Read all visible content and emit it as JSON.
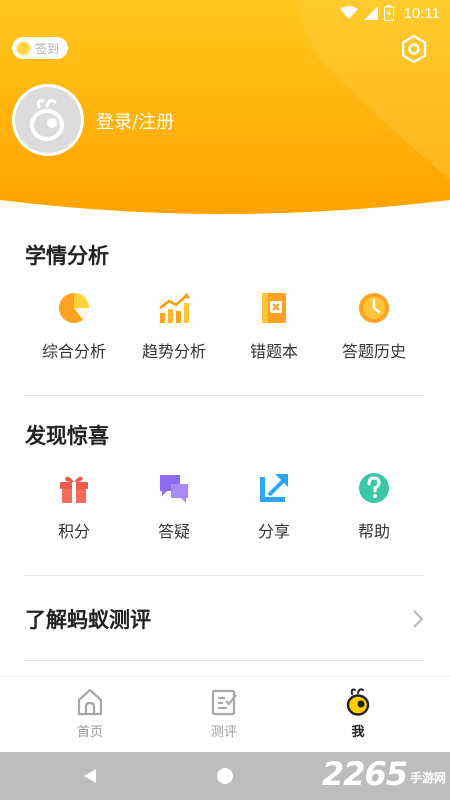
{
  "status_bar": {
    "time": "10:11"
  },
  "header": {
    "checkin_label": "签到",
    "login_label": "登录/注册"
  },
  "analysis": {
    "title": "学情分析",
    "items": [
      {
        "label": "综合分析",
        "icon": "pie-chart-icon"
      },
      {
        "label": "趋势分析",
        "icon": "trend-chart-icon"
      },
      {
        "label": "错题本",
        "icon": "wrong-book-icon"
      },
      {
        "label": "答题历史",
        "icon": "clock-history-icon"
      }
    ]
  },
  "surprise": {
    "title": "发现惊喜",
    "items": [
      {
        "label": "积分",
        "icon": "gift-icon"
      },
      {
        "label": "答疑",
        "icon": "chat-bubbles-icon"
      },
      {
        "label": "分享",
        "icon": "share-icon"
      },
      {
        "label": "帮助",
        "icon": "help-icon"
      }
    ]
  },
  "about": {
    "label": "了解蚂蚁测评"
  },
  "tabbar": {
    "tabs": [
      {
        "label": "首页",
        "icon": "home-icon",
        "active": false
      },
      {
        "label": "测评",
        "icon": "test-icon",
        "active": false
      },
      {
        "label": "我",
        "icon": "ant-logo-icon",
        "active": true
      }
    ]
  },
  "watermark": {
    "number": "2265",
    "site": "手游网"
  },
  "colors": {
    "brand_yellow": "#ffb300",
    "accent_orange": "#ff9800",
    "purple": "#8c6cf0",
    "blue": "#2ca5f5",
    "teal": "#3cc8a8",
    "red": "#f25b4b"
  }
}
